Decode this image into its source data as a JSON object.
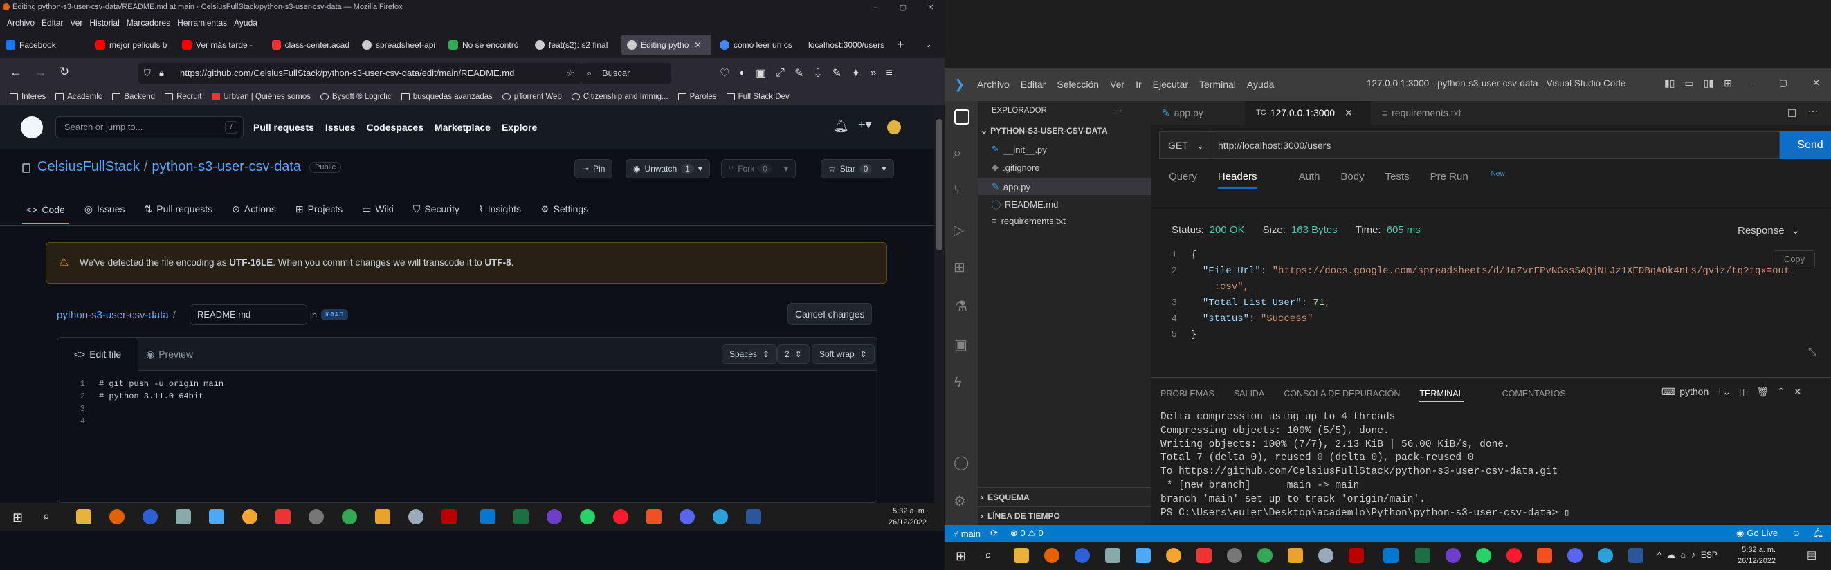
{
  "firefox": {
    "window_title": "Editing python-s3-user-csv-data/README.md at main · CelsiusFullStack/python-s3-user-csv-data — Mozilla Firefox",
    "menu": [
      "Archivo",
      "Editar",
      "Ver",
      "Historial",
      "Marcadores",
      "Herramientas",
      "Ayuda"
    ],
    "tabs": [
      {
        "label": "Facebook",
        "color": "#1877f2"
      },
      {
        "label": "mejor peliculs b",
        "color": "#ff0000"
      },
      {
        "label": "Ver más tarde -",
        "color": "#ff0000"
      },
      {
        "label": "class-center.acad",
        "color": "#e33"
      },
      {
        "label": "spreadsheet-api",
        "color": "#ccc"
      },
      {
        "label": "No se encontró",
        "color": "#34a853"
      },
      {
        "label": "feat(s2): s2 final",
        "color": "#ccc"
      },
      {
        "label": "Editing pytho",
        "color": "#ccc"
      },
      {
        "label": "como leer un cs",
        "color": "#4285f4"
      },
      {
        "label": "localhost:3000/users",
        "color": "#888"
      }
    ],
    "url": "https://github.com/CelsiusFullStack/python-s3-user-csv-data/edit/main/README.md",
    "search_placeholder": "Buscar",
    "bookmarks": [
      "Interes",
      "Academlo",
      "Backend",
      "Recruit",
      "Urbvan | Quiénes somos",
      "Bysoft ® Logictic",
      "busquedas avanzadas",
      "µTorrent Web",
      "Citizenship and Immig...",
      "Paroles",
      "Full Stack Dev"
    ]
  },
  "github": {
    "search_placeholder": "Search or jump to...",
    "slash": "/",
    "nav": [
      "Pull requests",
      "Issues",
      "Codespaces",
      "Marketplace",
      "Explore"
    ],
    "owner": "CelsiusFullStack",
    "repo": "python-s3-user-csv-data",
    "visibility": "Public",
    "pin": "Pin",
    "unwatch": "Unwatch",
    "unwatch_count": "1",
    "fork": "Fork",
    "fork_count": "0",
    "star": "Star",
    "star_count": "0",
    "tabs": [
      "Code",
      "Issues",
      "Pull requests",
      "Actions",
      "Projects",
      "Wiki",
      "Security",
      "Insights",
      "Settings"
    ],
    "warning_pre": "We've detected the file encoding as ",
    "warning_enc": "UTF-16LE",
    "warning_mid": ". When you commit changes we will transcode it to ",
    "warning_target": "UTF-8",
    "warning_end": ".",
    "path_repo": "python-s3-user-csv-data",
    "filename": "README.md",
    "in": "in",
    "branch": "main",
    "cancel": "Cancel changes",
    "edit_file": "Edit file",
    "preview": "Preview",
    "indent_mode": "Spaces",
    "indent_size": "2",
    "wrap_mode": "Soft wrap",
    "code_lines": [
      {
        "n": "1",
        "t": "# git push -u origin main"
      },
      {
        "n": "2",
        "t": "# python 3.11.0 64bit"
      },
      {
        "n": "3",
        "t": ""
      },
      {
        "n": "4",
        "t": ""
      }
    ]
  },
  "taskbar_left": {
    "time": "5:32 a. m.",
    "date": "26/12/2022"
  },
  "vscode": {
    "menu": [
      "Archivo",
      "Editar",
      "Selección",
      "Ver",
      "Ir",
      "Ejecutar",
      "Terminal",
      "Ayuda"
    ],
    "title": "127.0.0.1:3000 - python-s3-user-csv-data - Visual Studio Code",
    "explorer_title": "EXPLORADOR",
    "explorer_more": "···",
    "folder": "PYTHON-S3-USER-CSV-DATA",
    "files": [
      "__init__.py",
      ".gitignore",
      "app.py",
      "README.md",
      "requirements.txt"
    ],
    "outline": "ESQUEMA",
    "timeline": "LÍNEA DE TIEMPO",
    "tabs": [
      {
        "label": "app.py",
        "prefix": ""
      },
      {
        "label": "127.0.0.1:3000",
        "prefix": "TC"
      },
      {
        "label": "requirements.txt",
        "prefix": ""
      }
    ],
    "tc": {
      "method": "GET",
      "url": "http://localhost:3000/users",
      "send": "Send",
      "subtabs": [
        "Query",
        "Headers",
        "Auth",
        "Body",
        "Tests",
        "Pre Run"
      ],
      "new_badge": "New",
      "status_label": "Status:",
      "status": "200 OK",
      "size_label": "Size:",
      "size": "163 Bytes",
      "time_label": "Time:",
      "time": "605 ms",
      "response_label": "Response",
      "copy": "Copy",
      "body": [
        {
          "n": "1",
          "t": "{"
        },
        {
          "n": "2",
          "k": "\"File Url\"",
          "v": "\"https://docs.google.com/spreadsheets/d/1aZvrEPvNGssSAQjNLJz1XEDBqAOk4nLs/gviz/tq?tqx=out"
        },
        {
          "n": "",
          "v": ":csv\","
        },
        {
          "n": "3",
          "k": "\"Total List User\"",
          "num": "71,"
        },
        {
          "n": "4",
          "k": "\"status\"",
          "v": "\"Success\""
        },
        {
          "n": "5",
          "t": "}"
        }
      ]
    },
    "panel_tabs": [
      "PROBLEMAS",
      "SALIDA",
      "CONSOLA DE DEPURACIÓN",
      "TERMINAL",
      "COMENTARIOS"
    ],
    "terminal_shell": "python",
    "terminal": [
      "Delta compression using up to 4 threads",
      "Compressing objects: 100% (5/5), done.",
      "Writing objects: 100% (7/7), 2.13 KiB | 56.00 KiB/s, done.",
      "Total 7 (delta 0), reused 0 (delta 0), pack-reused 0",
      "To https://github.com/CelsiusFullStack/python-s3-user-csv-data.git",
      " * [new branch]      main -> main",
      "branch 'main' set up to track 'origin/main'.",
      "PS C:\\Users\\euler\\Desktop\\academlo\\Python\\python-s3-user-csv-data> ▯"
    ],
    "status_branch": "main",
    "status_problems": "⊗ 0 ⚠ 0",
    "status_golive": "Go Live",
    "taskbar_lang": "ESP",
    "taskbar_time": "5:32 a. m.",
    "taskbar_date": "26/12/2022"
  }
}
